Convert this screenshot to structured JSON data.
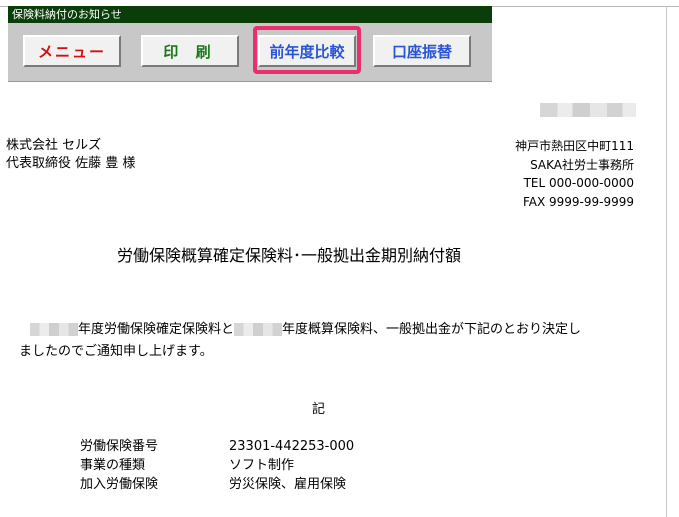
{
  "window": {
    "title": "保険料納付のお知らせ"
  },
  "toolbar": {
    "menu_label": "メニュー",
    "print_label": "印 刷",
    "compare_label": "前年度比較",
    "transfer_label": "口座振替",
    "highlight_color": "#e8306e"
  },
  "recipient": {
    "company": "株式会社 セルズ",
    "representative": "代表取締役 佐藤 豊 様"
  },
  "sender": {
    "address": "神戸市熱田区中町111",
    "office": "SAKA社労士事務所",
    "tel": "TEL 000-000-0000",
    "fax": "FAX 9999-99-9999"
  },
  "document": {
    "title": "労働保険概算確定保険料･一般拠出金期別納付額",
    "body_part1": "年度労働保険確定保険料と",
    "body_part2": "年度概算保険料、一般拠出金が下記のとおり決定し",
    "body_line2": "ましたのでご通知申し上げます。",
    "ki": "記"
  },
  "details": [
    {
      "label": "労働保険番号",
      "value": "23301-442253-000"
    },
    {
      "label": "事業の種類",
      "value": "ソフト制作"
    },
    {
      "label": "加入労働保険",
      "value": "労災保険、雇用保険"
    }
  ]
}
